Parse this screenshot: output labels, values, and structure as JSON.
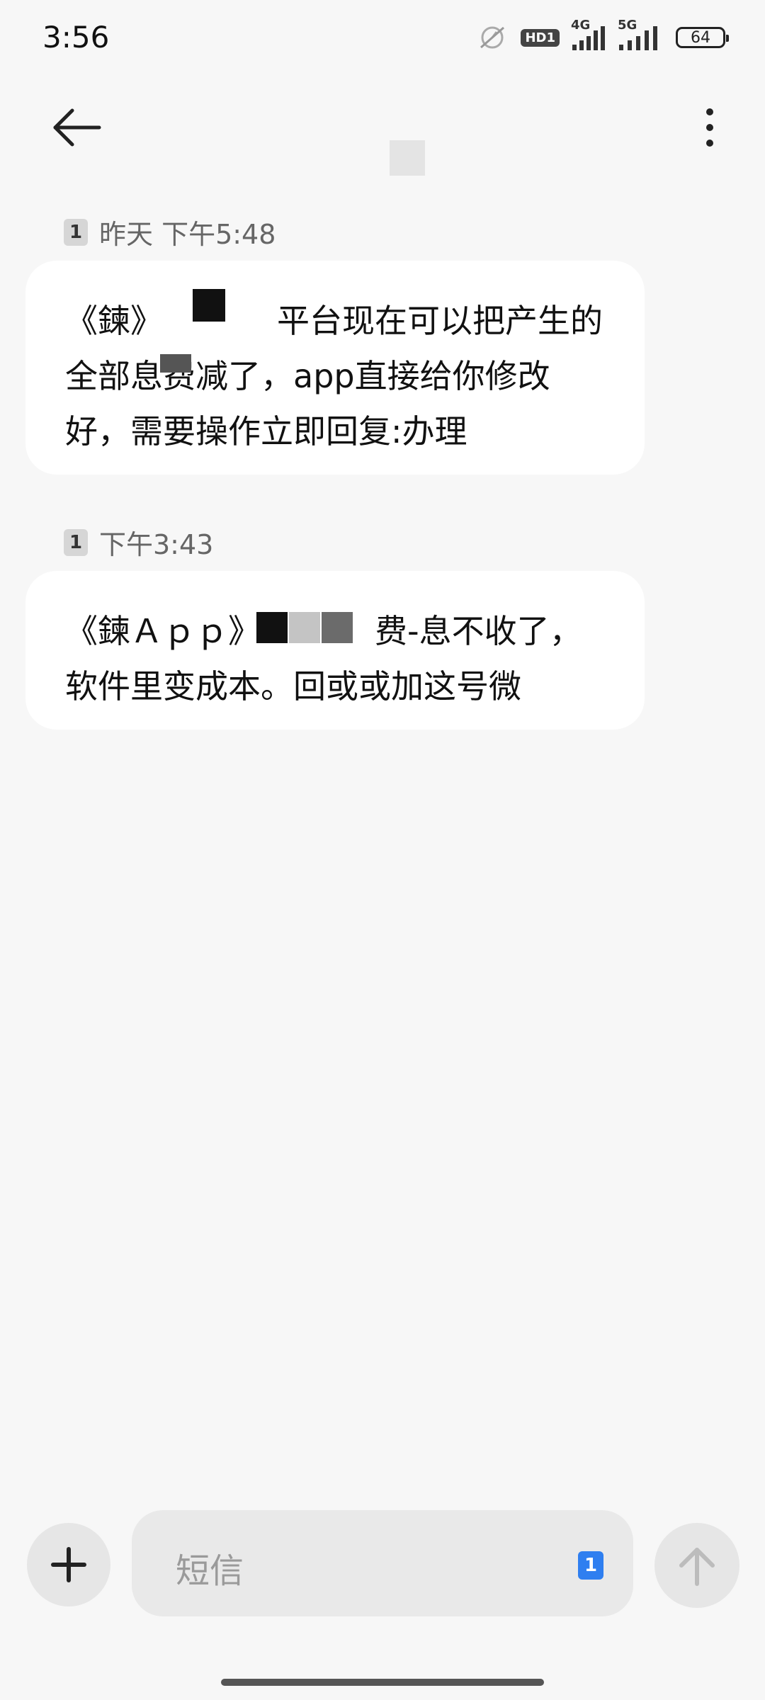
{
  "status_bar": {
    "time": "3:56",
    "network_1": "4G",
    "network_2": "5G",
    "hd_label": "HD1",
    "battery": "64"
  },
  "header": {
    "back_icon": "arrow-left-icon",
    "more_icon": "vertical-dots-icon"
  },
  "messages": [
    {
      "sim": "1",
      "time": "昨天 下午5:48",
      "text": "《鍊》　　　　平台现在可以把产生的全部息费减了，app直接给你修改好，需要操作立即回复:办理"
    },
    {
      "sim": "1",
      "time": "下午3:43",
      "text": "《鍊Ａｐｐ》　　　　费-息不收了，软件里变成本。回或或加这号微"
    }
  ],
  "compose": {
    "add_icon": "plus-icon",
    "placeholder": "短信",
    "sim": "1",
    "send_icon": "arrow-up-icon"
  }
}
